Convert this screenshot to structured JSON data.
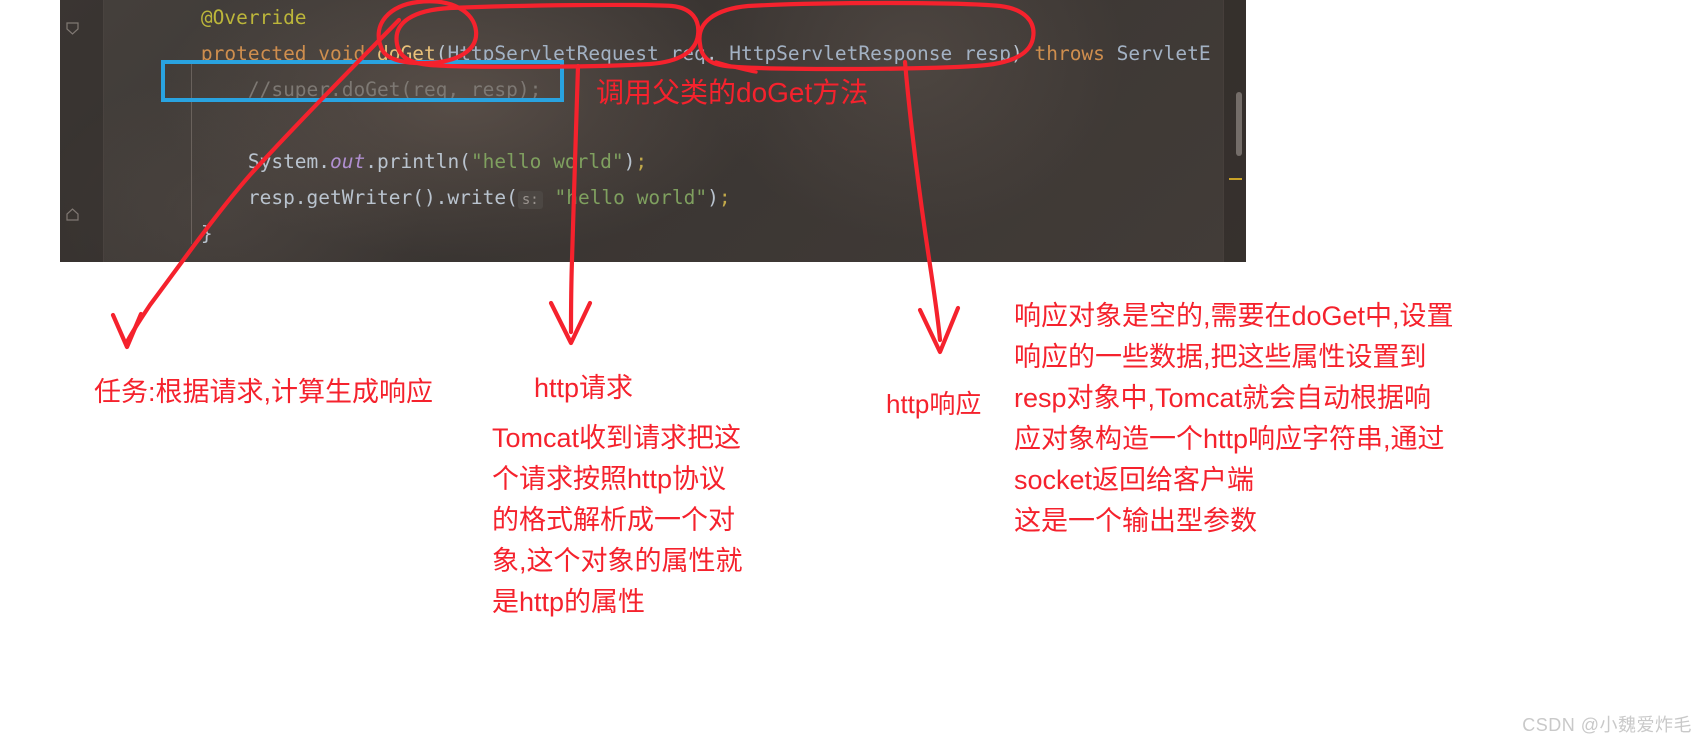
{
  "editor": {
    "language": "java",
    "code_lines": [
      {
        "indent": 4,
        "tokens": [
          {
            "cls": "tok-ann",
            "t": "@Override"
          }
        ]
      },
      {
        "indent": 4,
        "tokens": [
          {
            "cls": "tok-kw",
            "t": "protected void "
          },
          {
            "cls": "tok-meth",
            "t": "doGet"
          },
          {
            "cls": "tok-plain",
            "t": "("
          },
          {
            "cls": "tok-type",
            "t": "HttpServletRequest req"
          },
          {
            "cls": "tok-plain",
            "t": ", "
          },
          {
            "cls": "tok-type",
            "t": "HttpServletResponse resp"
          },
          {
            "cls": "tok-plain",
            "t": ") "
          },
          {
            "cls": "tok-kw",
            "t": "throws "
          },
          {
            "cls": "tok-type",
            "t": "ServletE"
          }
        ]
      },
      {
        "indent": 8,
        "tokens": [
          {
            "cls": "tok-cmt",
            "t": "//super.doGet(req, resp);"
          }
        ]
      },
      {
        "indent": 0,
        "tokens": []
      },
      {
        "indent": 8,
        "tokens": [
          {
            "cls": "tok-plain",
            "t": "System."
          },
          {
            "cls": "tok-field",
            "t": "out"
          },
          {
            "cls": "tok-plain",
            "t": ".println("
          },
          {
            "cls": "tok-str",
            "t": "\"hello world\""
          },
          {
            "cls": "tok-plain",
            "t": ")"
          },
          {
            "cls": "tok-punc",
            "t": ";"
          }
        ]
      },
      {
        "indent": 8,
        "tokens": [
          {
            "cls": "tok-plain",
            "t": "resp.getWriter().write("
          },
          {
            "cls": "hint",
            "t": "s:"
          },
          {
            "cls": "tok-str",
            "t": " \"hello world\""
          },
          {
            "cls": "tok-plain",
            "t": ")"
          },
          {
            "cls": "tok-punc",
            "t": ";"
          }
        ]
      },
      {
        "indent": 4,
        "tokens": [
          {
            "cls": "tok-plain",
            "t": "}"
          }
        ]
      }
    ]
  },
  "highlight": {
    "blue_box_target": "//super.doGet(req, resp);",
    "blue_color": "#29a3e0"
  },
  "annotations": {
    "marker_color": "#f5222d",
    "doget_method": "调用父类的doGet方法",
    "task": "任务:根据请求,计算生成响应",
    "http_request_label": "http请求",
    "http_request_body": "Tomcat收到请求把这\n个请求按照http协议\n的格式解析成一个对\n象,这个对象的属性就\n是http的属性",
    "http_response_label": "http响应",
    "http_response_body": "响应对象是空的,需要在doGet中,设置\n响应的一些数据,把这些属性设置到\nresp对象中,Tomcat就会自动根据响\n应对象构造一个http响应字符串,通过\nsocket返回给客户端\n这是一个输出型参数"
  },
  "watermark": {
    "text": "CSDN @小魏爱炸毛"
  }
}
